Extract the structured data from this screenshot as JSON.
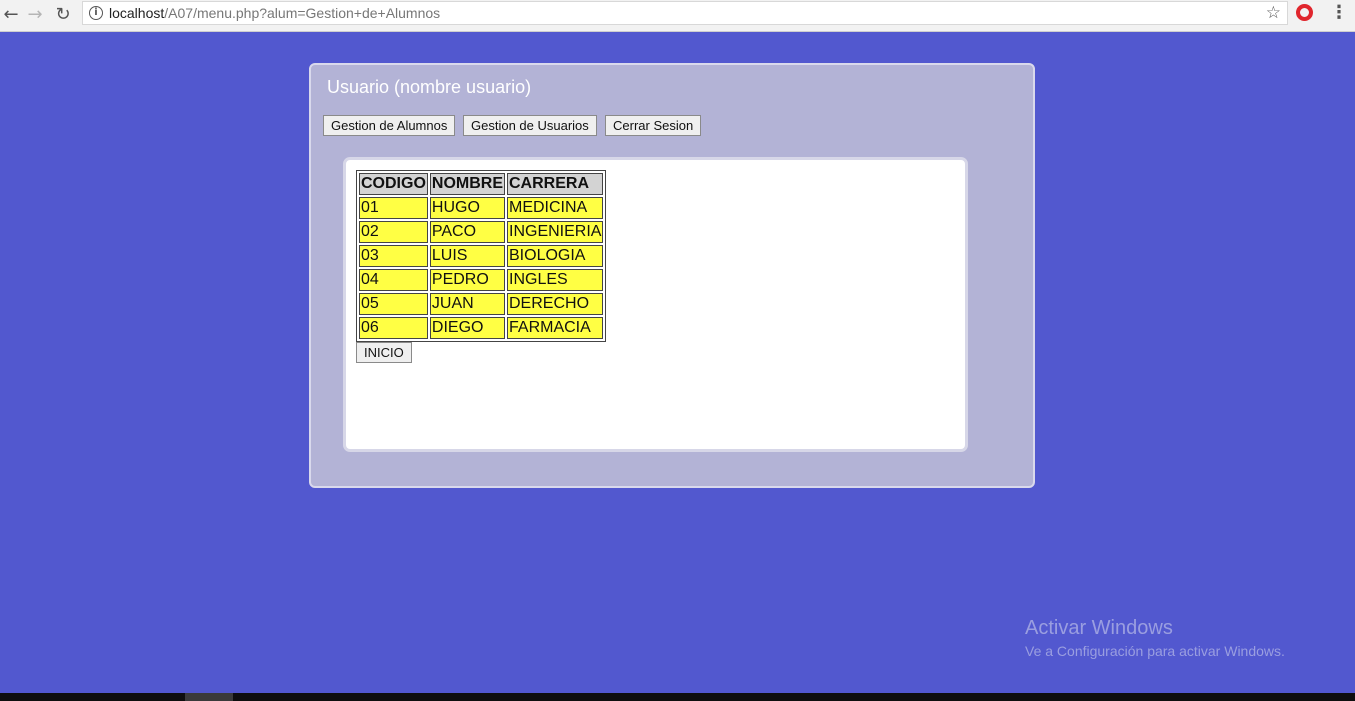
{
  "browser": {
    "url_host": "localhost",
    "url_path": "/A07/menu.php?alum=Gestion+de+Alumnos"
  },
  "panel": {
    "title": "Usuario (nombre usuario)",
    "buttons": {
      "alumnos": "Gestion de Alumnos",
      "usuarios": "Gestion de Usuarios",
      "cerrar": "Cerrar Sesion"
    }
  },
  "table": {
    "headers": [
      "CODIGO",
      "NOMBRE",
      "CARRERA"
    ],
    "rows": [
      [
        "01",
        "HUGO",
        "MEDICINA"
      ],
      [
        "02",
        "PACO",
        "INGENIERIA"
      ],
      [
        "03",
        "LUIS",
        "BIOLOGIA"
      ],
      [
        "04",
        "PEDRO",
        "INGLES"
      ],
      [
        "05",
        "JUAN",
        "DERECHO"
      ],
      [
        "06",
        "DIEGO",
        "FARMACIA"
      ]
    ]
  },
  "inicio_label": "INICIO",
  "watermark": {
    "line1": "Activar Windows",
    "line2": "Ve a Configuración para activar Windows."
  },
  "colors": {
    "page_bg": "#5258cf",
    "panel_bg": "#b3b3d6",
    "cell_bg": "#ffff44",
    "header_bg": "#d3d3d3"
  }
}
